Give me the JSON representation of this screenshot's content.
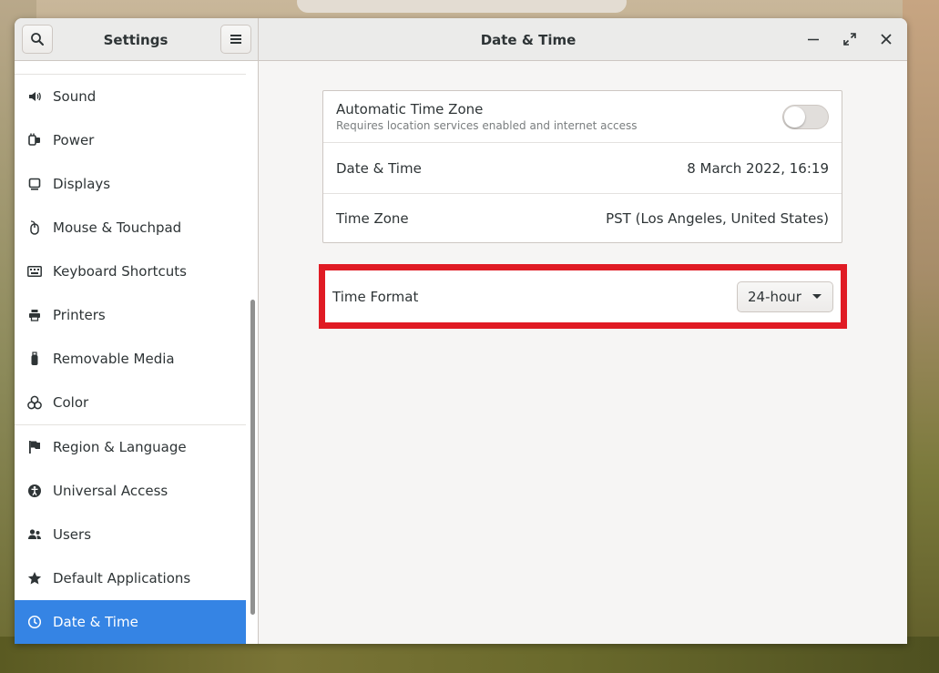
{
  "window": {
    "sidebar_title": "Settings",
    "main_title": "Date & Time"
  },
  "sidebar": {
    "items": [
      {
        "label": "Sound",
        "icon": "speaker-icon"
      },
      {
        "label": "Power",
        "icon": "power-plug-icon"
      },
      {
        "label": "Displays",
        "icon": "display-icon"
      },
      {
        "label": "Mouse & Touchpad",
        "icon": "mouse-icon"
      },
      {
        "label": "Keyboard Shortcuts",
        "icon": "keyboard-icon"
      },
      {
        "label": "Printers",
        "icon": "printer-icon"
      },
      {
        "label": "Removable Media",
        "icon": "usb-drive-icon"
      },
      {
        "label": "Color",
        "icon": "color-circles-icon"
      },
      {
        "label": "Region & Language",
        "icon": "flag-icon"
      },
      {
        "label": "Universal Access",
        "icon": "accessibility-icon"
      },
      {
        "label": "Users",
        "icon": "users-icon"
      },
      {
        "label": "Default Applications",
        "icon": "star-icon"
      },
      {
        "label": "Date & Time",
        "icon": "clock-icon",
        "active": true
      }
    ]
  },
  "datetime": {
    "auto_tz_title": "Automatic Time Zone",
    "auto_tz_subtitle": "Requires location services enabled and internet access",
    "auto_tz_enabled": false,
    "date_time_label": "Date & Time",
    "date_time_value": "8 March 2022, 16:19",
    "time_zone_label": "Time Zone",
    "time_zone_value": "PST (Los Angeles, United States)",
    "time_format_label": "Time Format",
    "time_format_value": "24-hour"
  },
  "colors": {
    "accent": "#3584e4",
    "highlight": "#e01b24"
  }
}
